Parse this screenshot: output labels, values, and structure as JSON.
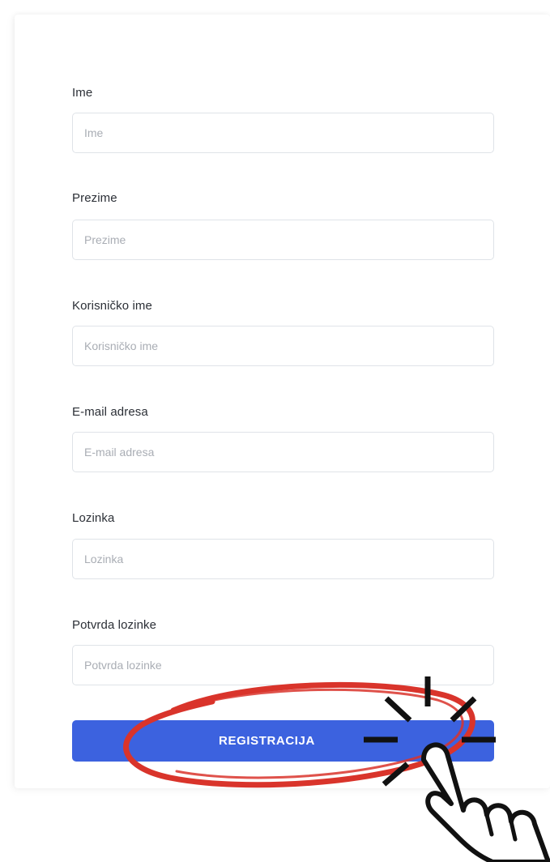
{
  "form": {
    "fields": [
      {
        "label": "Ime",
        "placeholder": "Ime"
      },
      {
        "label": "Prezime",
        "placeholder": "Prezime"
      },
      {
        "label": "Korisničko ime",
        "placeholder": "Korisničko ime"
      },
      {
        "label": "E-mail adresa",
        "placeholder": "E-mail adresa"
      },
      {
        "label": "Lozinka",
        "placeholder": "Lozinka"
      },
      {
        "label": "Potvrda lozinke",
        "placeholder": "Potvrda lozinke"
      }
    ],
    "submit_label": "REGISTRACIJA"
  },
  "colors": {
    "button": "#3c62df",
    "annotation_circle": "#d9342b",
    "annotation_hand": "#111111"
  }
}
